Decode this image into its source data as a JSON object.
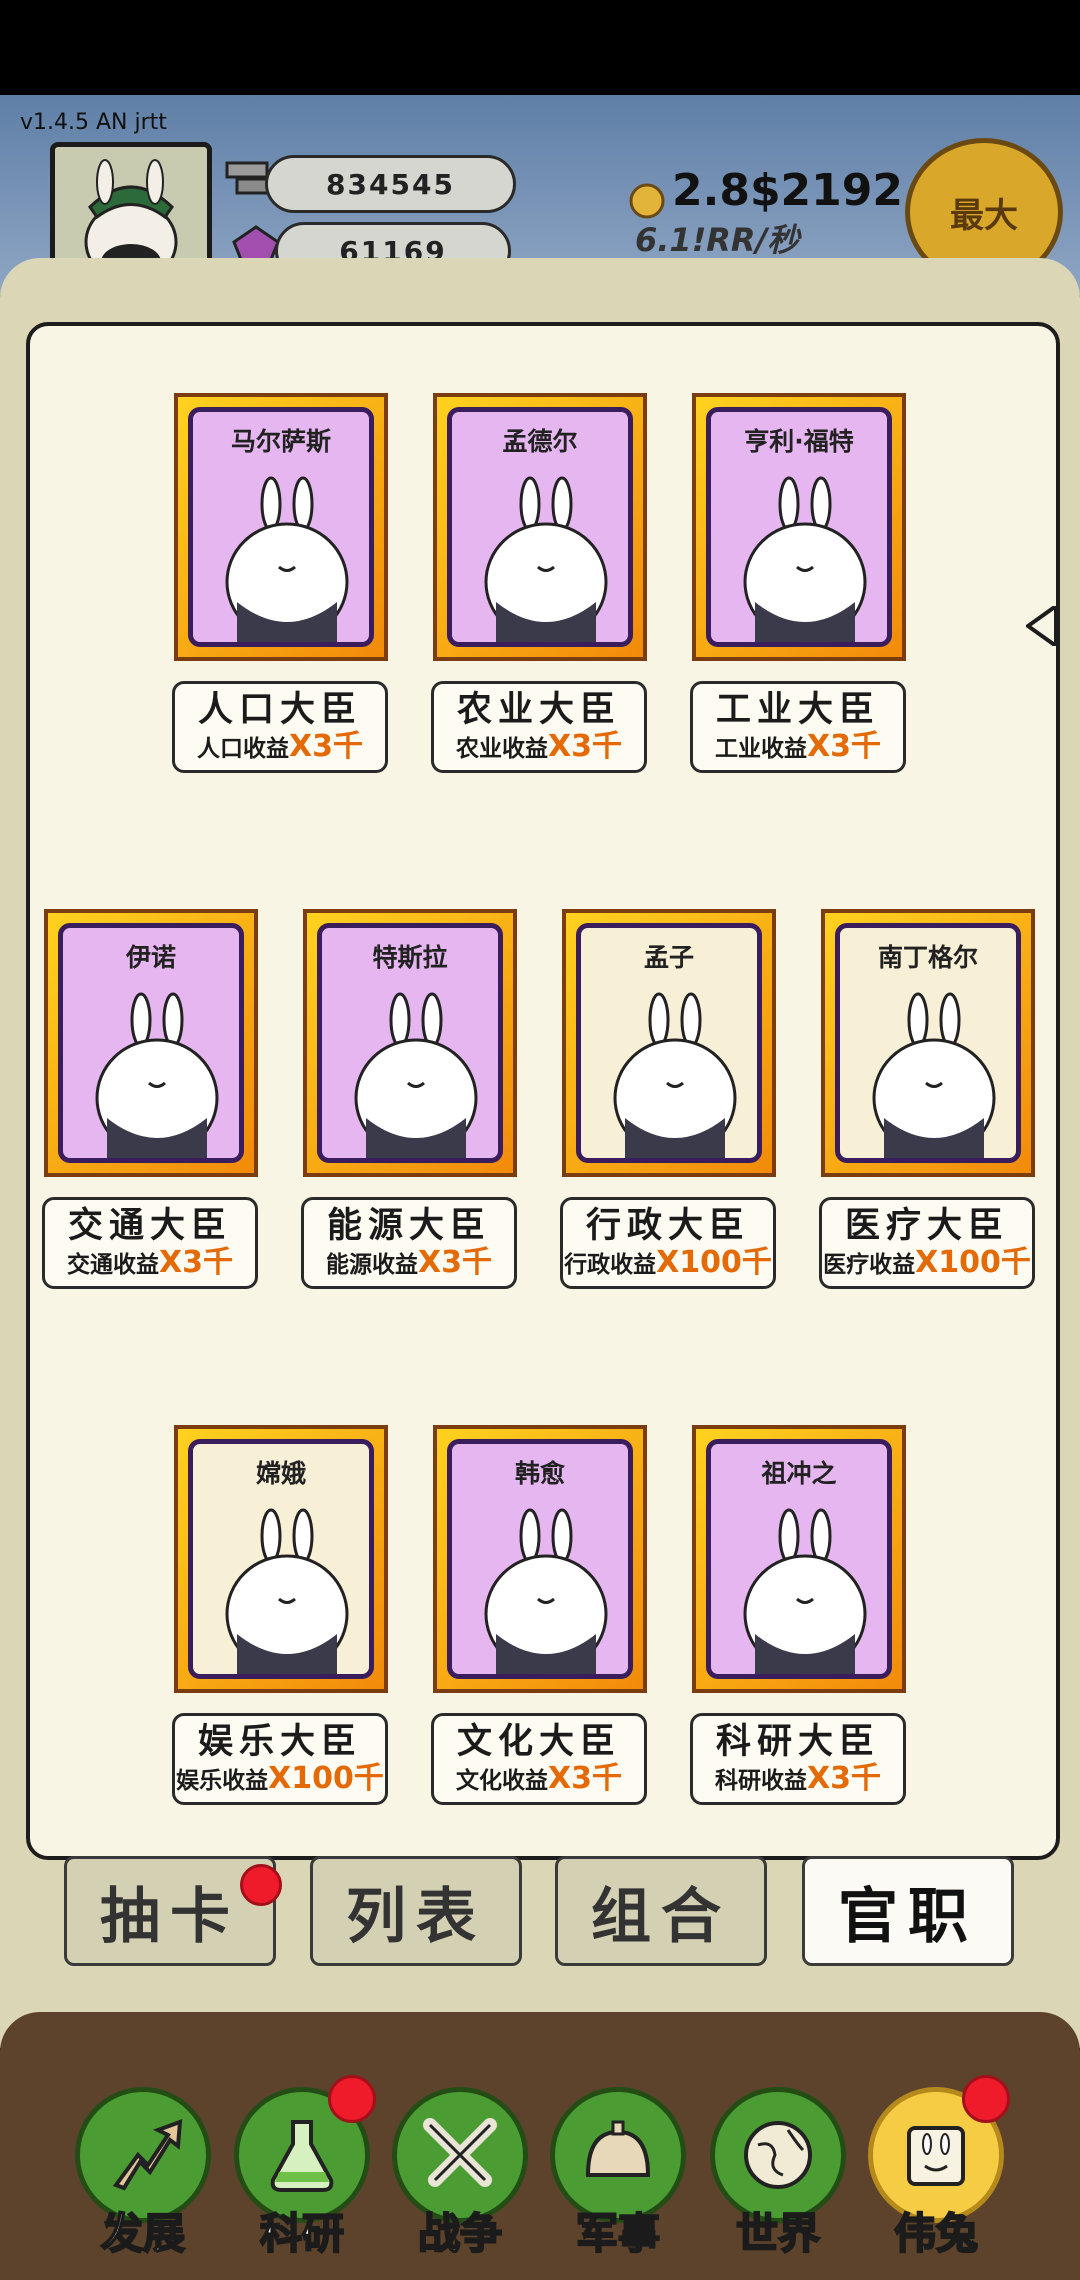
{
  "version": "v1.4.5 AN jrtt",
  "resources": {
    "ingots": "834545",
    "gems": "61169",
    "coins": "2.8$2192",
    "rate": "6.1!RR/秒"
  },
  "max_button": "最大",
  "ministers": [
    {
      "name": "马尔萨斯",
      "title": "人口大臣",
      "bonus_label": "人口收益",
      "bonus_mult": "X3千",
      "bg": "purple"
    },
    {
      "name": "孟德尔",
      "title": "农业大臣",
      "bonus_label": "农业收益",
      "bonus_mult": "X3千",
      "bg": "purple"
    },
    {
      "name": "亨利·福特",
      "title": "工业大臣",
      "bonus_label": "工业收益",
      "bonus_mult": "X3千",
      "bg": "purple"
    },
    {
      "name": "伊诺",
      "title": "交通大臣",
      "bonus_label": "交通收益",
      "bonus_mult": "X3千",
      "bg": "purple"
    },
    {
      "name": "特斯拉",
      "title": "能源大臣",
      "bonus_label": "能源收益",
      "bonus_mult": "X3千",
      "bg": "purple"
    },
    {
      "name": "孟子",
      "title": "行政大臣",
      "bonus_label": "行政收益",
      "bonus_mult": "X100千",
      "bg": "beige"
    },
    {
      "name": "南丁格尔",
      "title": "医疗大臣",
      "bonus_label": "医疗收益",
      "bonus_mult": "X100千",
      "bg": "beige"
    },
    {
      "name": "嫦娥",
      "title": "娱乐大臣",
      "bonus_label": "娱乐收益",
      "bonus_mult": "X100千",
      "bg": "beige"
    },
    {
      "name": "韩愈",
      "title": "文化大臣",
      "bonus_label": "文化收益",
      "bonus_mult": "X3千",
      "bg": "purple"
    },
    {
      "name": "祖冲之",
      "title": "科研大臣",
      "bonus_label": "科研收益",
      "bonus_mult": "X3千",
      "bg": "purple"
    }
  ],
  "tabs": [
    {
      "label": "抽卡",
      "badge": true
    },
    {
      "label": "列表",
      "badge": false
    },
    {
      "label": "组合",
      "badge": false
    },
    {
      "label": "官职",
      "badge": false,
      "active": true
    }
  ],
  "nav": [
    {
      "label": "发展",
      "icon": "arrow-up-icon",
      "badge": false
    },
    {
      "label": "科研",
      "icon": "flask-icon",
      "badge": true
    },
    {
      "label": "战争",
      "icon": "crossed-swords-icon",
      "badge": false
    },
    {
      "label": "军事",
      "icon": "helmet-icon",
      "badge": false
    },
    {
      "label": "世界",
      "icon": "globe-icon",
      "badge": false
    },
    {
      "label": "伟兔",
      "icon": "rabbit-portrait-icon",
      "badge": true,
      "active": true
    }
  ],
  "colors": {
    "card_purple": "#e6b6f0",
    "card_beige": "#f8efd7",
    "multiplier": "#e46a08",
    "nav_green": "#4b9d33",
    "nav_active": "#f7cc45",
    "badge_red": "#ef1b2b"
  }
}
